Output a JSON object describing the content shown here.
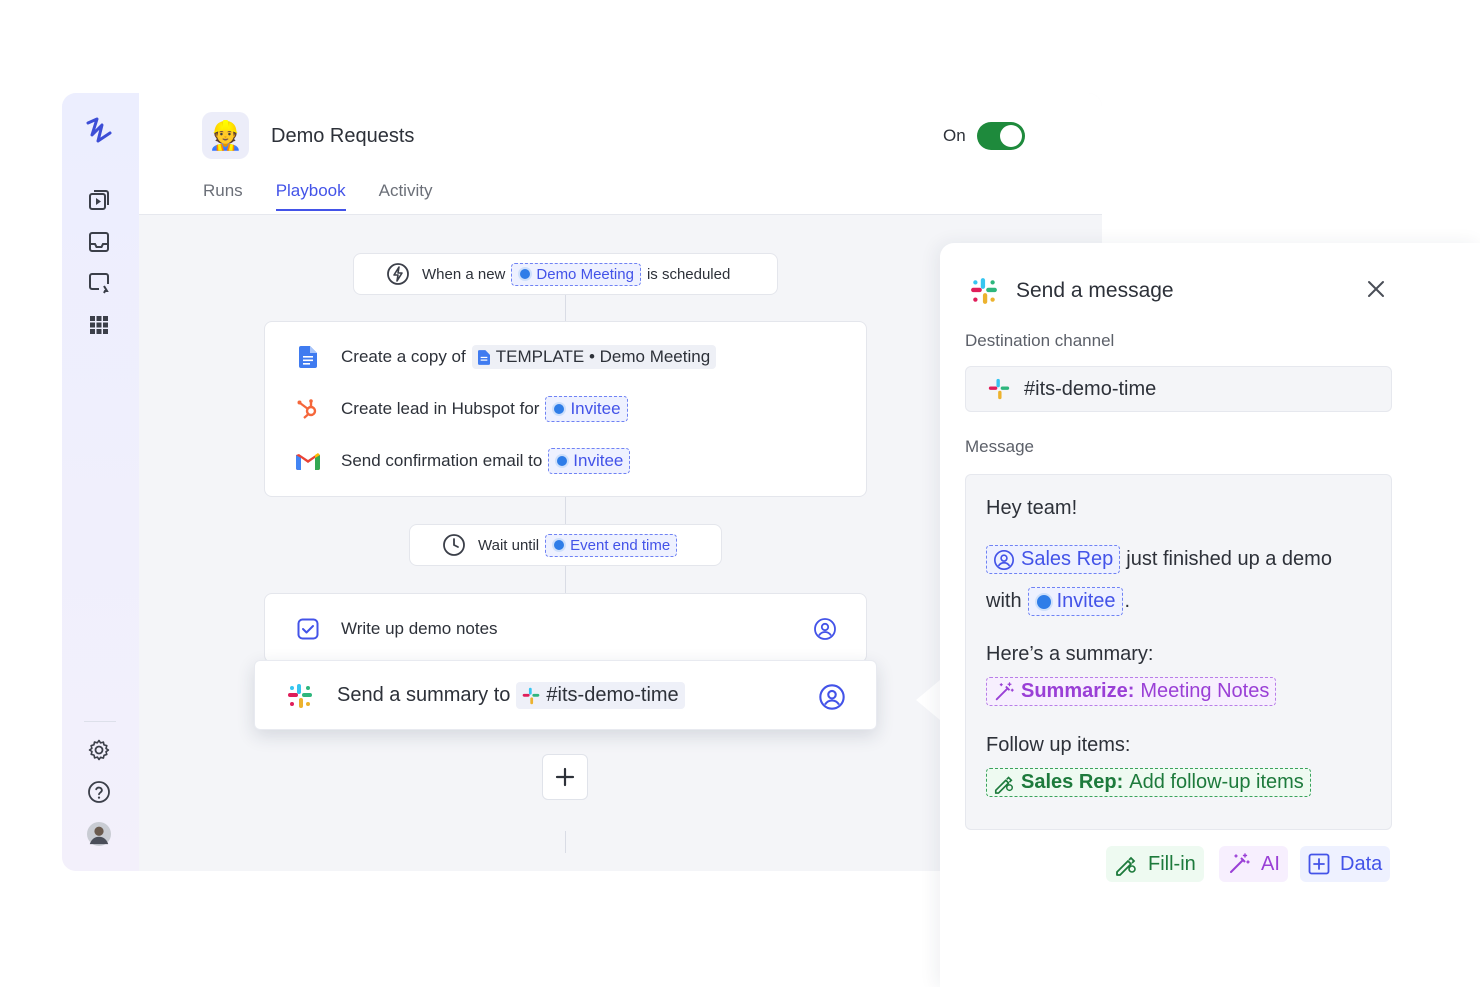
{
  "app": {
    "title": "Demo Requests",
    "status_label": "On",
    "status_on": true,
    "accent": "#4353e8",
    "emoji": "👷"
  },
  "tabs": [
    {
      "label": "Runs",
      "active": false
    },
    {
      "label": "Playbook",
      "active": true
    },
    {
      "label": "Activity",
      "active": false
    }
  ],
  "trigger": {
    "prefix": "When a new",
    "chip": "Demo Meeting",
    "suffix": "is scheduled"
  },
  "steps": [
    {
      "icon": "google-docs-icon",
      "prefix": "Create a copy of",
      "chip": "TEMPLATE • Demo Meeting"
    },
    {
      "icon": "hubspot-icon",
      "prefix": "Create lead in Hubspot for",
      "chip": "Invitee"
    },
    {
      "icon": "gmail-icon",
      "prefix": "Send confirmation email to",
      "chip": "Invitee"
    }
  ],
  "wait": {
    "prefix": "Wait until",
    "chip": "Event end time"
  },
  "task": {
    "label": "Write up demo notes"
  },
  "summary_step": {
    "prefix": "Send a summary to",
    "chip": "#its-demo-time"
  },
  "panel": {
    "title": "Send a message",
    "destination_label": "Destination channel",
    "destination_value": "#its-demo-time",
    "message_label": "Message",
    "message": {
      "greeting": "Hey team!",
      "sales_rep_chip": "Sales Rep",
      "line2_text": "just finished up a demo",
      "with_text": "with",
      "invitee_chip": "Invitee",
      "period": ".",
      "summary_intro": "Here’s a summary:",
      "summarize_bold": "Summarize:",
      "summarize_rest": "Meeting Notes",
      "followup_intro": "Follow up items:",
      "followup_bold": "Sales Rep:",
      "followup_rest": "Add follow-up items"
    },
    "tools": [
      {
        "label": "Fill-in",
        "color": "#1d7a3c"
      },
      {
        "label": "AI",
        "color": "#9a3fd6"
      },
      {
        "label": "Data",
        "color": "#4353e8"
      }
    ]
  }
}
